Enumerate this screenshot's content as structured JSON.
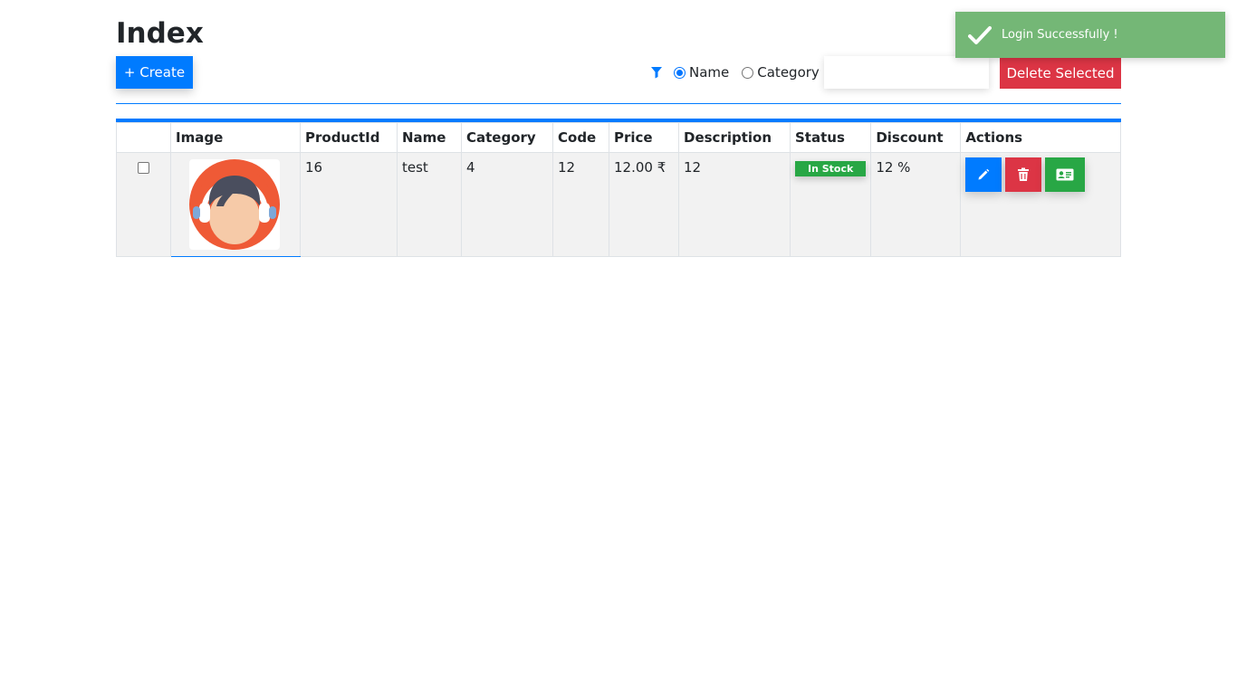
{
  "page": {
    "title": "Index"
  },
  "toolbar": {
    "create_label": "+ Create",
    "filter_options": [
      {
        "label": "Name",
        "checked": true
      },
      {
        "label": "Category",
        "checked": false
      }
    ],
    "search_value": "",
    "delete_selected_label": "Delete Selected"
  },
  "table": {
    "headers": [
      "",
      "Image",
      "ProductId",
      "Name",
      "Category",
      "Code",
      "Price",
      "Description",
      "Status",
      "Discount",
      "Actions"
    ],
    "rows": [
      {
        "checked": false,
        "product_id": "16",
        "name": "test",
        "category": "4",
        "code": "12",
        "price": "12.00 ₹",
        "description": "12",
        "status": "In Stock",
        "discount": "12 %"
      }
    ]
  },
  "toast": {
    "message": "Login Successfully !"
  },
  "icons": {
    "filter": "filter-icon",
    "edit": "pencil-icon",
    "delete": "trash-icon",
    "details": "id-card-icon",
    "toast": "checkmark-icon"
  },
  "colors": {
    "primary": "#007bff",
    "danger": "#dc3545",
    "success": "#28a745",
    "toast": "#74b776"
  }
}
